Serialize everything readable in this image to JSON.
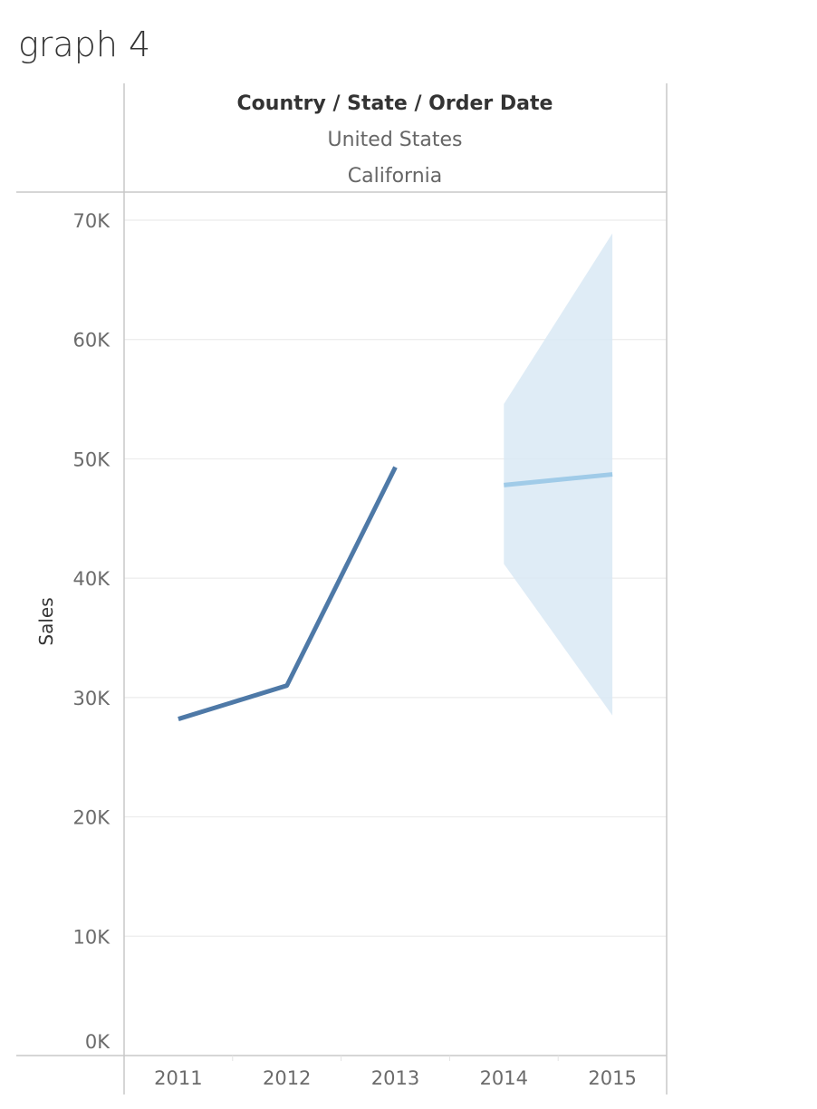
{
  "page": {
    "title": "graph 4"
  },
  "header": {
    "title": "Country / State / Order Date",
    "country": "United States",
    "state": "California"
  },
  "colors": {
    "actual_line": "#4e79a7",
    "forecast_line": "#a0cbe8",
    "forecast_band": "#d9e9f5",
    "grid": "#ececec",
    "frame": "#c8c8c8"
  },
  "chart_data": {
    "type": "line",
    "ylabel": "Sales",
    "xlabel": "",
    "ylim": [
      0,
      70000
    ],
    "yticks": [
      {
        "value": 0,
        "label": "0K"
      },
      {
        "value": 10000,
        "label": "10K"
      },
      {
        "value": 20000,
        "label": "20K"
      },
      {
        "value": 30000,
        "label": "30K"
      },
      {
        "value": 40000,
        "label": "40K"
      },
      {
        "value": 50000,
        "label": "50K"
      },
      {
        "value": 60000,
        "label": "60K"
      },
      {
        "value": 70000,
        "label": "70K"
      }
    ],
    "categories": [
      "2011",
      "2012",
      "2013",
      "2014",
      "2015"
    ],
    "grid": true,
    "series": [
      {
        "kind": "actual",
        "x": [
          "2011",
          "2012",
          "2013"
        ],
        "values": [
          28200,
          31000,
          49300
        ]
      },
      {
        "kind": "forecast",
        "x": [
          "2014",
          "2015"
        ],
        "values": [
          47800,
          48700
        ],
        "lower": [
          41200,
          28500
        ],
        "upper": [
          54600,
          68900
        ]
      }
    ]
  }
}
